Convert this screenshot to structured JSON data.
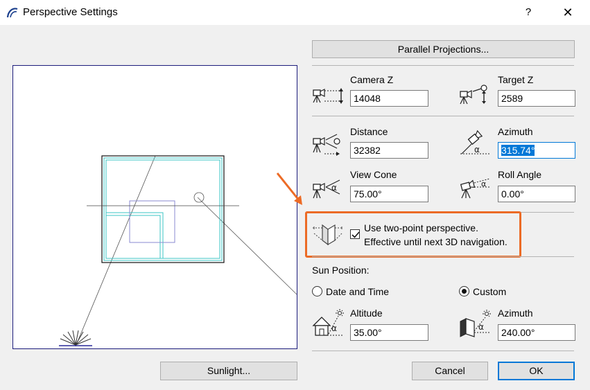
{
  "window": {
    "title": "Perspective Settings",
    "help_label": "?",
    "close_label": "✕"
  },
  "buttons": {
    "parallel_projections": "Parallel Projections...",
    "sunlight": "Sunlight...",
    "cancel": "Cancel",
    "ok": "OK"
  },
  "camera": {
    "camera_z": {
      "label": "Camera Z",
      "value": "14048",
      "icon": "camera-height-icon"
    },
    "target_z": {
      "label": "Target Z",
      "value": "2589",
      "icon": "target-height-icon"
    },
    "distance": {
      "label": "Distance",
      "value": "32382",
      "icon": "camera-distance-icon"
    },
    "azimuth": {
      "label": "Azimuth",
      "value": "315.74°",
      "icon": "camera-azimuth-icon"
    },
    "view_cone": {
      "label": "View Cone",
      "value": "75.00°",
      "icon": "view-cone-icon"
    },
    "roll_angle": {
      "label": "Roll Angle",
      "value": "0.00°",
      "icon": "roll-angle-icon"
    }
  },
  "two_point": {
    "line1": "Use two-point perspective.",
    "line2": "Effective until next 3D navigation.",
    "checked": true,
    "icon": "two-point-perspective-icon"
  },
  "sun": {
    "heading": "Sun Position:",
    "option_date_time": "Date and Time",
    "option_custom": "Custom",
    "selected": "Custom",
    "altitude": {
      "label": "Altitude",
      "value": "35.00°",
      "icon": "sun-altitude-icon"
    },
    "azimuth": {
      "label": "Azimuth",
      "value": "240.00°",
      "icon": "sun-azimuth-icon"
    }
  },
  "colors": {
    "highlight": "#ec6b26",
    "selection": "#0078d7",
    "plan_cyan": "#3bc4c4"
  }
}
